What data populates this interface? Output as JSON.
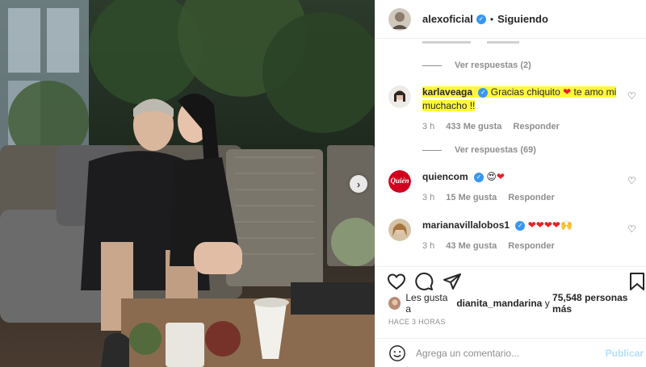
{
  "header": {
    "username": "alexoficial",
    "follow_status": "Siguiendo"
  },
  "thread": {
    "view_replies_1": "Ver respuestas (2)",
    "view_replies_2": "Ver respuestas (69)"
  },
  "comments": [
    {
      "username": "karlaveaga",
      "verified": true,
      "text_before": "Gracias chiquito",
      "text_after": "te amo mi muchacho !!",
      "time": "3 h",
      "likes": "433 Me gusta",
      "reply": "Responder",
      "highlight_color": "#fff83a"
    },
    {
      "username": "quiencom",
      "verified": true,
      "time": "3 h",
      "likes": "15 Me gusta",
      "reply": "Responder",
      "logo_text": "Quién"
    },
    {
      "username": "marianavillalobos1",
      "verified": true,
      "time": "3 h",
      "likes": "43 Me gusta",
      "reply": "Responder"
    }
  ],
  "likes": {
    "prefix": "Les gusta a",
    "user": "dianita_mandarina",
    "middle": "y",
    "count": "75,548 personas más"
  },
  "post": {
    "time_ago": "HACE 3 HORAS"
  },
  "composer": {
    "placeholder": "Agrega un comentario...",
    "publish_label": "Publicar"
  },
  "colors": {
    "verified": "#3897f0",
    "publish_disabled": "#b2dffc",
    "heart": "#ed1c24",
    "quien_red": "#d1001f"
  }
}
